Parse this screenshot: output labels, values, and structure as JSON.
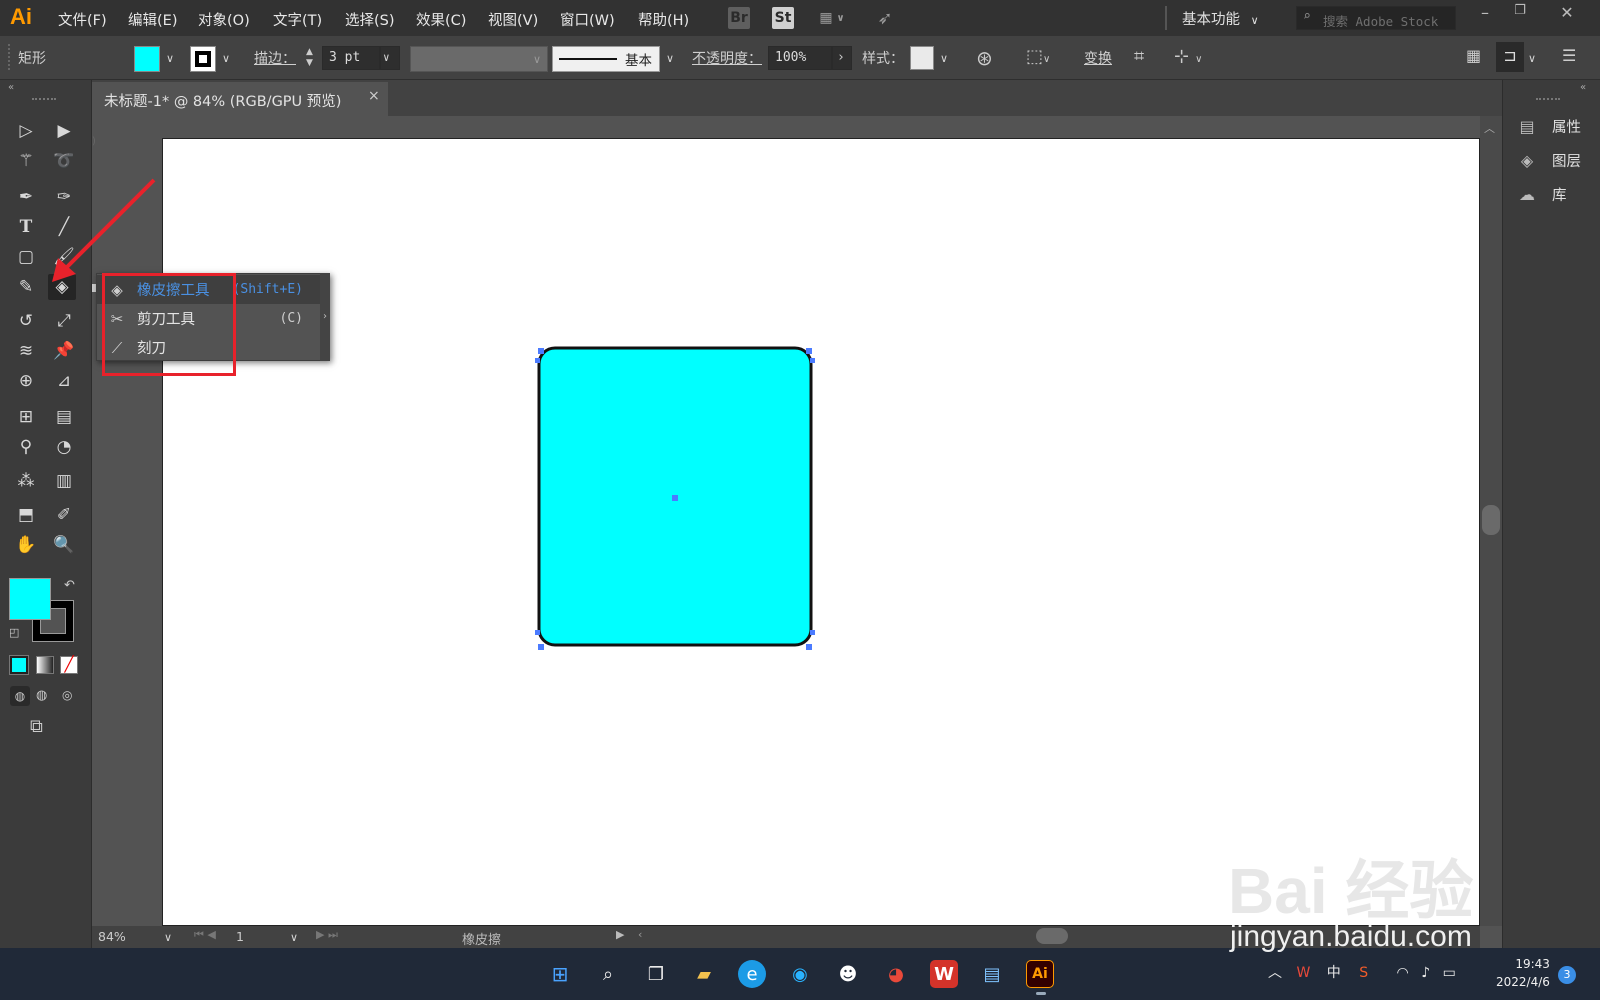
{
  "app": {
    "logo": "Ai"
  },
  "menu": {
    "items": [
      {
        "label": "文件(F)"
      },
      {
        "label": "编辑(E)"
      },
      {
        "label": "对象(O)"
      },
      {
        "label": "文字(T)"
      },
      {
        "label": "选择(S)"
      },
      {
        "label": "效果(C)"
      },
      {
        "label": "视图(V)"
      },
      {
        "label": "窗口(W)"
      },
      {
        "label": "帮助(H)"
      }
    ],
    "bridge": "Br",
    "stock": "St",
    "workspace": "基本功能",
    "search_placeholder": "搜索 Adobe Stock"
  },
  "control": {
    "selection_type": "矩形",
    "stroke_label": "描边：",
    "stroke_value": "3 pt",
    "stroke_profile": "基本",
    "opacity_label": "不透明度：",
    "opacity_value": "100%",
    "style_label": "样式：",
    "transform_label": "变换",
    "fill_color": "#00ffff",
    "stroke_color": "#000000"
  },
  "document": {
    "tab_title": "未标题-1* @ 84% (RGB/GPU 预览)",
    "close_glyph": "×"
  },
  "flyout": {
    "items": [
      {
        "label": "橡皮擦工具",
        "shortcut": "(Shift+E)",
        "icon": "eraser-icon",
        "selected": true
      },
      {
        "label": "剪刀工具",
        "shortcut": "(C)",
        "icon": "scissors-icon",
        "selected": false
      },
      {
        "label": "刻刀",
        "shortcut": "",
        "icon": "knife-icon",
        "selected": false
      }
    ]
  },
  "right_panel": {
    "items": [
      {
        "label": "属性",
        "icon": "properties-icon"
      },
      {
        "label": "图层",
        "icon": "layers-icon"
      },
      {
        "label": "库",
        "icon": "libraries-icon"
      }
    ]
  },
  "status": {
    "zoom": "84%",
    "artboard": "1",
    "current_tool": "橡皮擦"
  },
  "taskbar": {
    "tray_lang": "中",
    "time": "19:43",
    "date": "2022/4/6",
    "notification_count": "3"
  },
  "watermark": {
    "logo": "Bai 经验",
    "url": "jingyan.baidu.com"
  }
}
